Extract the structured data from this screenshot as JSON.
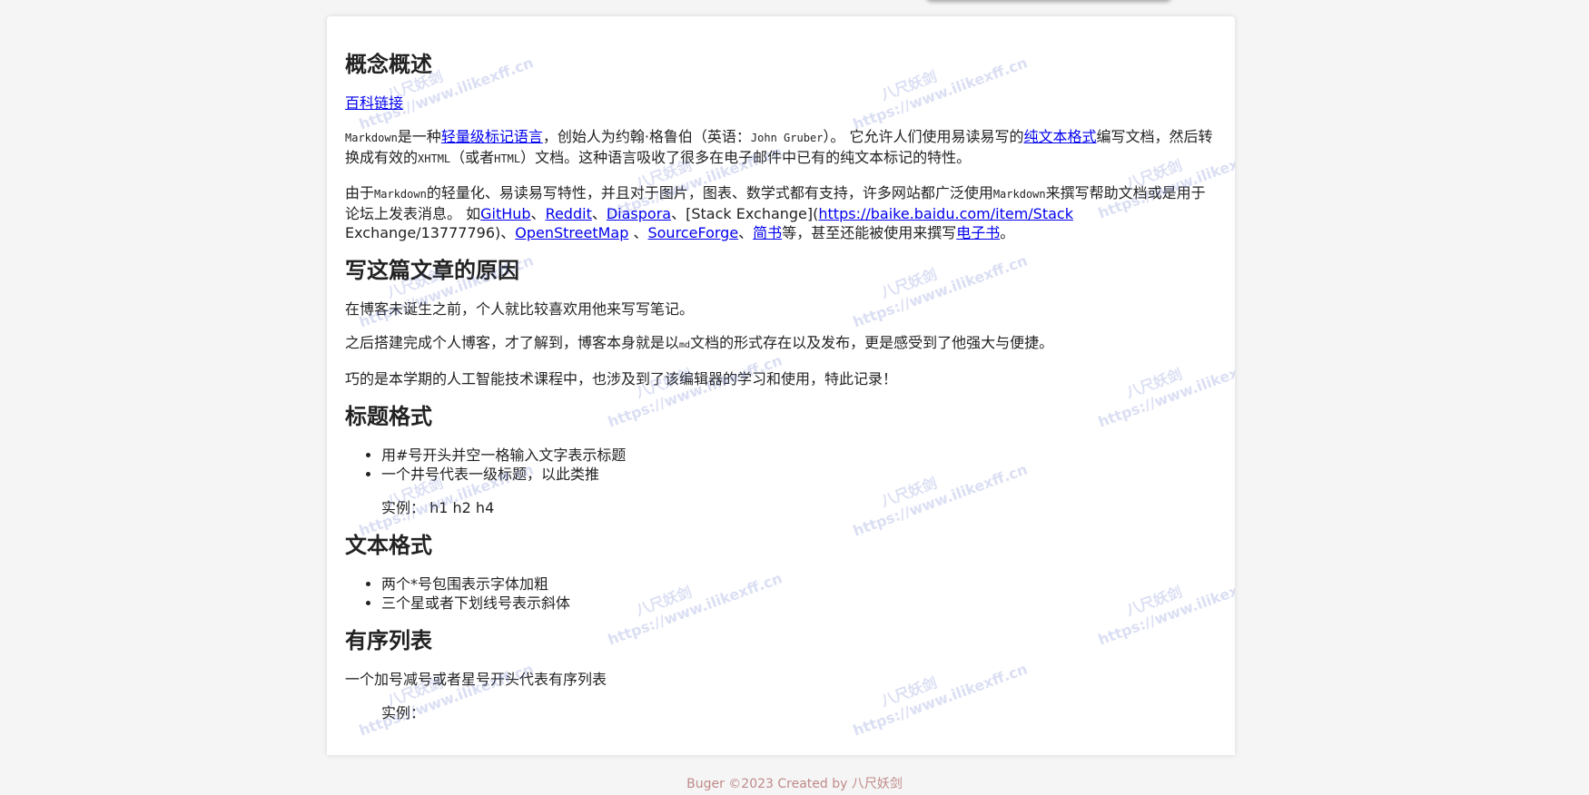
{
  "sections": [
    {
      "heading": "概念概述",
      "link": "百科链接",
      "p1": {
        "t1": "Markdown",
        "t2": "是一种",
        "link1": "轻量级标记语言",
        "t3": "，创始人为约翰·格鲁伯（英语：",
        "t4": "John Gruber",
        "t5": "）。 它允许人们使用易读易写的",
        "link2": "纯文本格式",
        "t6": "编写文档，然后转换成有效的",
        "t7": "XHTML",
        "t8": "（或者",
        "t9": "HTML",
        "t10": "）文档。这种语言吸收了很多在电子邮件中已有的纯文本标记的特性。"
      },
      "p2": {
        "t1": "由于",
        "t2": "Markdown",
        "t3": "的轻量化、易读易写特性，并且对于图片，图表、数学式都有支持，许多网站都广泛使用",
        "t4": "Markdown",
        "t5": "来撰写帮助文档或是用于论坛上发表消息。 如",
        "link1": "GitHub",
        "sep1": "、",
        "link2": "Reddit",
        "sep2": "、",
        "link3": "Diaspora",
        "t6": "、[Stack Exchange](",
        "link4": "https://baike.baidu.com/item/Stack",
        "t7": " Exchange/13777796)、",
        "link5": "OpenStreetMap",
        "sep3": " 、",
        "link6": "SourceForge",
        "sep4": "、",
        "link7": "简书",
        "t8": "等，甚至还能被使用来撰写",
        "link8": "电子书",
        "t9": "。"
      }
    }
  ],
  "why": {
    "heading": "写这篇文章的原因",
    "p1": "在博客未诞生之前，个人就比较喜欢用他来写写笔记。",
    "p2a": "之后搭建完成个人博客，才了解到，博客本身就是以",
    "p2b": "md",
    "p2c": "文档的形式存在以及发布，更是感受到了他强大与便捷。",
    "p3": "巧的是本学期的人工智能技术课程中，也涉及到了该编辑器的学习和使用，特此记录！"
  },
  "title_format": {
    "heading": "标题格式",
    "items": [
      "用#号开头并空一格输入文字表示标题",
      "一个井号代表一级标题，以此类推"
    ],
    "example_label": "实例：",
    "example_values": "h1 h2 h4"
  },
  "text_format": {
    "heading": "文本格式",
    "items": [
      "两个*号包围表示字体加粗",
      "三个星或者下划线号表示斜体"
    ]
  },
  "ordered_list": {
    "heading": "有序列表",
    "p1": "一个加号减号或者星号开头代表有序列表",
    "example_label": "实例："
  },
  "watermark": {
    "cn": "八尺妖剑",
    "url": "https://www.ilikexff.cn"
  },
  "footer": "Buger ©2023 Created by 八尺妖剑"
}
